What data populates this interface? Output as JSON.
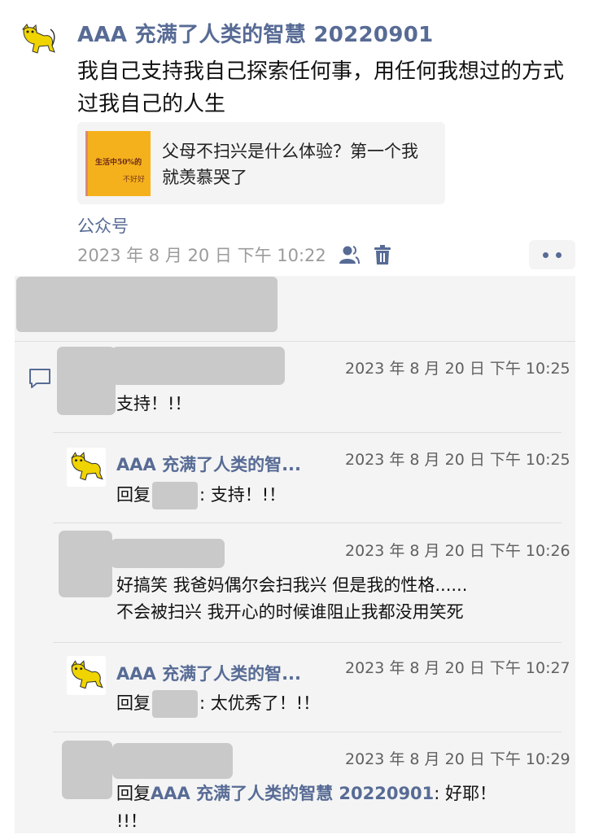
{
  "post": {
    "author": "AAA 充满了人类的智慧 20220901",
    "text": "我自己支持我自己探索任何事，用任何我想过的方式过我自己的人生",
    "link_card": {
      "title": "父母不扫兴是什么体验？第一个我就羡慕哭了",
      "thumb_text_1": "生活中50%的",
      "thumb_text_2": "不好好"
    },
    "source": "公众号",
    "timestamp": "2023 年 8 月 20 日 下午 10:22"
  },
  "icons": {
    "avatar": "cat-avatar-icon",
    "visibility": "person-icon",
    "delete": "trash-icon",
    "more": "more-dots-icon",
    "comment": "comment-bubble-icon"
  },
  "colors": {
    "link_blue": "#576b95",
    "comment_bg": "#f4f4f4",
    "blur_gray": "#c9c9c9",
    "avatar_yellow": "#f0d400"
  },
  "comments": [
    {
      "time": "2023 年 8 月 20 日 下午 10:25",
      "text": "支持！!！"
    },
    {
      "name": "AAA 充满了人类的智...",
      "time": "2023 年 8 月 20 日 下午 10:25",
      "prefix": "回复",
      "suffix": ": 支持！!！"
    },
    {
      "time": "2023 年 8 月 20 日 下午 10:26",
      "line1": "好搞笑 我爸妈偶尔会扫我兴 但是我的性格......",
      "line2": "不会被扫兴 我开心的时候谁阻止我都没用笑死"
    },
    {
      "name": "AAA 充满了人类的智...",
      "time": "2023 年 8 月 20 日 下午 10:27",
      "prefix": "回复",
      "suffix": ": 太优秀了！!！"
    },
    {
      "time": "2023 年 8 月 20 日 下午 10:29",
      "prefix": "回复",
      "link": "AAA 充满了人类的智慧 20220901",
      "suffix": ": 好耶！",
      "line2": "!!！"
    }
  ]
}
